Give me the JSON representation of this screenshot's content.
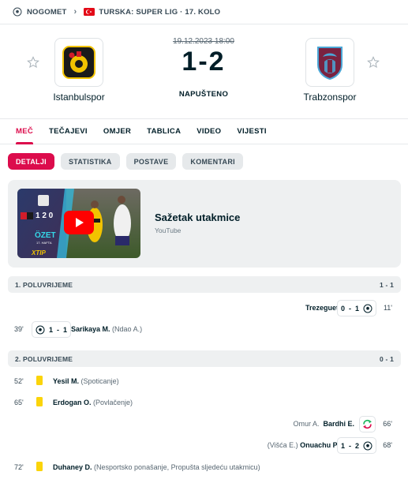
{
  "breadcrumb": {
    "sport": "NOGOMET",
    "competition": "TURSKA: SUPER LIG · 17. KOLO"
  },
  "match": {
    "datetime": "19.12.2023 18:00",
    "score_home": "1",
    "score_sep": "-",
    "score_away": "2",
    "status": "NAPUŠTENO",
    "home_team": "Istanbulspor",
    "away_team": "Trabzonspor"
  },
  "tabs": [
    "MEČ",
    "TEČAJEVI",
    "OMJER",
    "TABLICA",
    "VIDEO",
    "VIJESTI"
  ],
  "subtabs": [
    "DETALJI",
    "STATISTIKA",
    "POSTAVE",
    "KOMENTARI"
  ],
  "video": {
    "title": "Sažetak utakmice",
    "source": "YouTube",
    "thumb_score": "1 2 0",
    "thumb_word": "ÖZET",
    "thumb_sub": "17. HAFTA",
    "thumb_brand": "XTIP"
  },
  "periods": [
    {
      "label": "1. POLUVRIJEME",
      "score": "1 - 1"
    },
    {
      "label": "2. POLUVRIJEME",
      "score": "0 - 1"
    }
  ],
  "events": {
    "e1": {
      "minute": "11'",
      "player": "Trezeguet",
      "score_a": "0",
      "score_b": "1"
    },
    "e2": {
      "minute": "39'",
      "player": "Sarikaya M.",
      "extra": "(Ndao A.)",
      "score_a": "1",
      "score_b": "1"
    },
    "e3": {
      "minute": "52'",
      "player": "Yesil M.",
      "extra": "(Spoticanje)"
    },
    "e4": {
      "minute": "65'",
      "player": "Erdogan O.",
      "extra": "(Povlačenje)"
    },
    "e5": {
      "minute": "66'",
      "player_in": "Bardhi E.",
      "player_out": "Omur A."
    },
    "e6": {
      "minute": "68'",
      "player": "Onuachu P.",
      "extra": "(Višća E.)",
      "score_a": "1",
      "score_b": "2"
    },
    "e7": {
      "minute": "72'",
      "player": "Duhaney D.",
      "extra": "(Nesportsko ponašanje, Propušta sljedeću utakmicu)"
    }
  },
  "colors": {
    "accent": "#dc0c4c",
    "yellow_card": "#fbd40a",
    "section_bg": "#eef0f1"
  }
}
